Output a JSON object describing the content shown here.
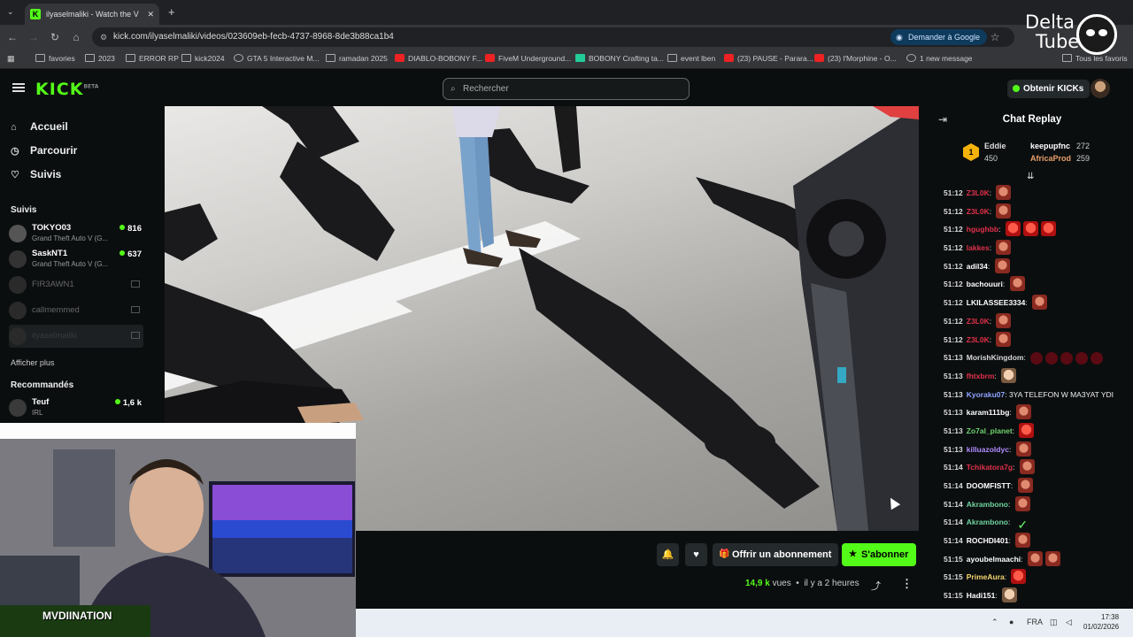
{
  "browser": {
    "tab_title": "ilyaselmaliki - Watch the V",
    "url": "kick.com/ilyaselmaliki/videos/023609eb-fecb-4737-8968-8de3b88ca1b4",
    "ask_google": "Demander à Google",
    "bookmarks": [
      {
        "label": "favories",
        "kind": "folder"
      },
      {
        "label": "2023",
        "kind": "folder"
      },
      {
        "label": "ERROR RP",
        "kind": "folder"
      },
      {
        "label": "kick2024",
        "kind": "folder"
      },
      {
        "label": "GTA 5 Interactive M...",
        "kind": "globe"
      },
      {
        "label": "ramadan 2025",
        "kind": "folder"
      },
      {
        "label": "DIABLO-BOBONY F...",
        "kind": "youtube"
      },
      {
        "label": "FiveM Underground...",
        "kind": "youtube"
      },
      {
        "label": "BOBONY Crafting ta...",
        "kind": "sheet"
      },
      {
        "label": "event lben",
        "kind": "folder"
      },
      {
        "label": "(23) PAUSE - Parara...",
        "kind": "youtube"
      },
      {
        "label": "(23) l'Morphine - O...",
        "kind": "youtube"
      },
      {
        "label": "1 new message",
        "kind": "mail"
      },
      {
        "label": "Tous les favoris",
        "kind": "folder"
      }
    ]
  },
  "header": {
    "logo": "KICK",
    "logo_beta": "BETA",
    "search_placeholder": "Rechercher",
    "get_kicks": "Obtenir KICKs"
  },
  "sidebar": {
    "nav": [
      {
        "label": "Accueil",
        "icon": "home-icon"
      },
      {
        "label": "Parcourir",
        "icon": "compass-icon"
      },
      {
        "label": "Suivis",
        "icon": "heart-icon"
      }
    ],
    "followed_title": "Suivis",
    "followed": [
      {
        "name": "TOKYO03",
        "game": "Grand Theft Auto V (G...",
        "viewers": "816",
        "live": true
      },
      {
        "name": "SaskNT1",
        "game": "Grand Theft Auto V (G...",
        "viewers": "637",
        "live": true
      },
      {
        "name": "FIR3AWN1",
        "live": false
      },
      {
        "name": "callmemmed",
        "live": false
      },
      {
        "name": "ilyaselmaliki",
        "live": false
      }
    ],
    "show_more": "Afficher plus",
    "recommended_title": "Recommandés",
    "recommended": [
      {
        "name": "Teuf",
        "game": "IRL",
        "viewers": "1,6 k"
      }
    ]
  },
  "video_actions": {
    "gift_label": "Offrir un abonnement",
    "subscribe_label": "S'abonner",
    "views": "14,9 k",
    "views_suffix": "vues",
    "time_ago": "il y a 2 heures"
  },
  "webcam": {
    "banner": "MVDIINATION"
  },
  "chat": {
    "title": "Chat Replay",
    "pinned": {
      "rank": "1",
      "top_user": "Eddie",
      "top_amount": "450",
      "second_user": "keepupfnc",
      "second_amount": "272",
      "third_user": "AfricaProd",
      "third_amount": "259"
    },
    "messages": [
      {
        "time": "51:12",
        "user": "Z3L0K",
        "color": "#e0304a",
        "text": "",
        "emotes": [
          "face"
        ]
      },
      {
        "time": "51:12",
        "user": "Z3L0K",
        "color": "#e0304a",
        "text": "",
        "emotes": [
          "face"
        ]
      },
      {
        "time": "51:12",
        "user": "hgughbb",
        "color": "#e0304a",
        "text": "",
        "emotes": [
          "red",
          "red",
          "red"
        ]
      },
      {
        "time": "51:12",
        "user": "lakkes",
        "color": "#e0304a",
        "text": "",
        "emotes": [
          "face"
        ]
      },
      {
        "time": "51:12",
        "user": "adil34",
        "color": "#ffffff",
        "text": "",
        "emotes": [
          "face"
        ]
      },
      {
        "time": "51:12",
        "user": "bachouuri",
        "color": "#ffffff",
        "text": "",
        "emotes": [
          "face"
        ]
      },
      {
        "time": "51:12",
        "user": "LKILASSEE3334",
        "color": "#ffffff",
        "text": "",
        "emotes": [
          "face"
        ]
      },
      {
        "time": "51:12",
        "user": "Z3L0K",
        "color": "#e0304a",
        "text": "",
        "emotes": [
          "face"
        ]
      },
      {
        "time": "51:12",
        "user": "Z3L0K",
        "color": "#e0304a",
        "text": "",
        "emotes": [
          "face"
        ]
      },
      {
        "time": "51:13",
        "user": "MorishKingdom",
        "color": "#d8d8d8",
        "text": "",
        "emotes": [
          "dark",
          "dark",
          "dark",
          "dark",
          "dark"
        ]
      },
      {
        "time": "51:13",
        "user": "fhtxbrm",
        "color": "#e0304a",
        "text": "",
        "emotes": [
          "pal"
        ]
      },
      {
        "time": "51:13",
        "user": "Kyoraku07",
        "color": "#8fa4ff",
        "text": "3YA TELEFON W MA3YAT YDI",
        "emotes": []
      },
      {
        "time": "51:13",
        "user": "karam111bg",
        "color": "#ffffff",
        "text": "",
        "emotes": [
          "face"
        ]
      },
      {
        "time": "51:13",
        "user": "Zo7al_planet",
        "color": "#6fd36f",
        "text": "",
        "emotes": [
          "red"
        ]
      },
      {
        "time": "51:13",
        "user": "killuazoldyc",
        "color": "#b08cff",
        "text": "",
        "emotes": [
          "face"
        ]
      },
      {
        "time": "51:14",
        "user": "Tchikatora7g",
        "color": "#e0304a",
        "text": "",
        "emotes": [
          "face"
        ]
      },
      {
        "time": "51:14",
        "user": "DOOMFISTT",
        "color": "#ffffff",
        "text": "",
        "emotes": [
          "face"
        ]
      },
      {
        "time": "51:14",
        "user": "Akrambono",
        "color": "#6fd3a0",
        "text": "",
        "emotes": [
          "face"
        ]
      },
      {
        "time": "51:14",
        "user": "Akrambono",
        "color": "#6fd3a0",
        "text": "",
        "emotes": [
          "grn"
        ]
      },
      {
        "time": "51:14",
        "user": "ROCHDI401",
        "color": "#ffffff",
        "text": "",
        "emotes": [
          "face"
        ]
      },
      {
        "time": "51:15",
        "user": "ayoubelmaachi",
        "color": "#ffffff",
        "text": "",
        "emotes": [
          "face",
          "face"
        ]
      },
      {
        "time": "51:15",
        "user": "PrimeAura",
        "color": "#f5d76e",
        "text": "",
        "emotes": [
          "red"
        ]
      },
      {
        "time": "51:15",
        "user": "Hadi151",
        "color": "#ffffff",
        "text": "",
        "emotes": [
          "pal"
        ]
      }
    ]
  },
  "taskbar": {
    "lang": "FRA",
    "time": "17:38",
    "date": "01/02/2026"
  },
  "watermark": {
    "line1": "Delta",
    "line2": "Tube"
  }
}
